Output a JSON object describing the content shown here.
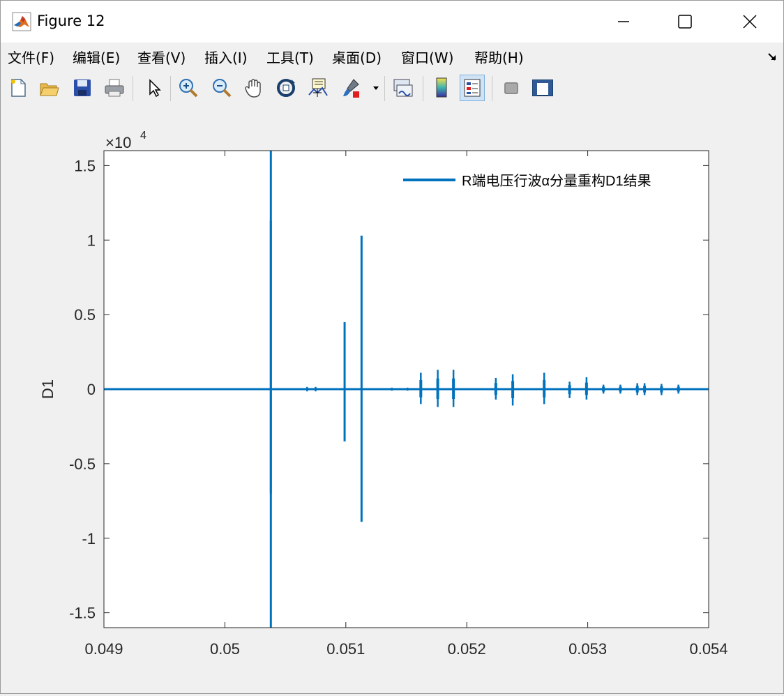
{
  "window": {
    "title": "Figure 12",
    "icon": "matlab-icon",
    "controls": [
      "minimize-icon",
      "maximize-icon",
      "close-icon"
    ]
  },
  "menu": {
    "items": [
      {
        "label": "文件(F)",
        "mnemonic": "F"
      },
      {
        "label": "编辑(E)",
        "mnemonic": "E"
      },
      {
        "label": "查看(V)",
        "mnemonic": "V"
      },
      {
        "label": "插入(I)",
        "mnemonic": "I"
      },
      {
        "label": "工具(T)",
        "mnemonic": "T"
      },
      {
        "label": "桌面(D)",
        "mnemonic": "D"
      },
      {
        "label": "窗口(W)",
        "mnemonic": "W"
      },
      {
        "label": "帮助(H)",
        "mnemonic": "H"
      }
    ],
    "dock_icon": "dock-arrow-icon"
  },
  "toolbar": {
    "tools": [
      "new-figure-icon",
      "open-file-icon",
      "save-icon",
      "print-icon",
      "select-arrow-icon",
      "zoom-in-icon",
      "zoom-out-icon",
      "pan-hand-icon",
      "rotate-3d-icon",
      "data-cursor-icon",
      "brush-icon",
      "link-plot-icon",
      "colorbar-icon",
      "legend-icon",
      "hide-plot-tools-icon",
      "show-plot-tools-icon"
    ],
    "active_tool": "legend-icon"
  },
  "chart_data": {
    "type": "line",
    "title": "",
    "xlabel": "",
    "ylabel": "D1",
    "exponent_label": "×10",
    "exponent_power": "4",
    "xlim": [
      0.049,
      0.054
    ],
    "ylim": [
      -16000,
      16000
    ],
    "xticks": [
      "0.049",
      "0.05",
      "0.051",
      "0.052",
      "0.053",
      "0.054"
    ],
    "yticks": [
      "-1.5",
      "-1",
      "-0.5",
      "0",
      "0.5",
      "1",
      "1.5"
    ],
    "ytick_values": [
      -15000,
      -10000,
      -5000,
      0,
      5000,
      10000,
      15000
    ],
    "legend": {
      "location": "top-right",
      "entries": [
        "R端电压行波α分量重构D1结果"
      ]
    },
    "color": "#0072bd",
    "series": [
      {
        "name": "R端电压行波α分量重构D1结果",
        "spikes": [
          {
            "x": 0.05038,
            "max": 16000,
            "min": -16000
          },
          {
            "x": 0.05038,
            "max": 11300,
            "min": -7000
          },
          {
            "x": 0.05068,
            "max": 150,
            "min": -150
          },
          {
            "x": 0.05075,
            "max": 150,
            "min": -150
          },
          {
            "x": 0.05099,
            "max": 4500,
            "min": -3500
          },
          {
            "x": 0.05113,
            "max": 10300,
            "min": -8900
          },
          {
            "x": 0.05138,
            "max": 100,
            "min": -100
          },
          {
            "x": 0.05151,
            "max": 100,
            "min": -100
          },
          {
            "x": 0.05162,
            "max": 1100,
            "min": -1000
          },
          {
            "x": 0.05176,
            "max": 1300,
            "min": -1200
          },
          {
            "x": 0.05189,
            "max": 1300,
            "min": -1200
          },
          {
            "x": 0.05224,
            "max": 750,
            "min": -700
          },
          {
            "x": 0.05238,
            "max": 1000,
            "min": -1100
          },
          {
            "x": 0.05264,
            "max": 1100,
            "min": -1000
          },
          {
            "x": 0.05285,
            "max": 500,
            "min": -600
          },
          {
            "x": 0.05299,
            "max": 800,
            "min": -700
          },
          {
            "x": 0.05313,
            "max": 300,
            "min": -300
          },
          {
            "x": 0.05327,
            "max": 300,
            "min": -300
          },
          {
            "x": 0.05341,
            "max": 400,
            "min": -400
          },
          {
            "x": 0.05347,
            "max": 400,
            "min": -400
          },
          {
            "x": 0.05361,
            "max": 350,
            "min": -400
          },
          {
            "x": 0.05375,
            "max": 300,
            "min": -300
          }
        ]
      }
    ]
  }
}
